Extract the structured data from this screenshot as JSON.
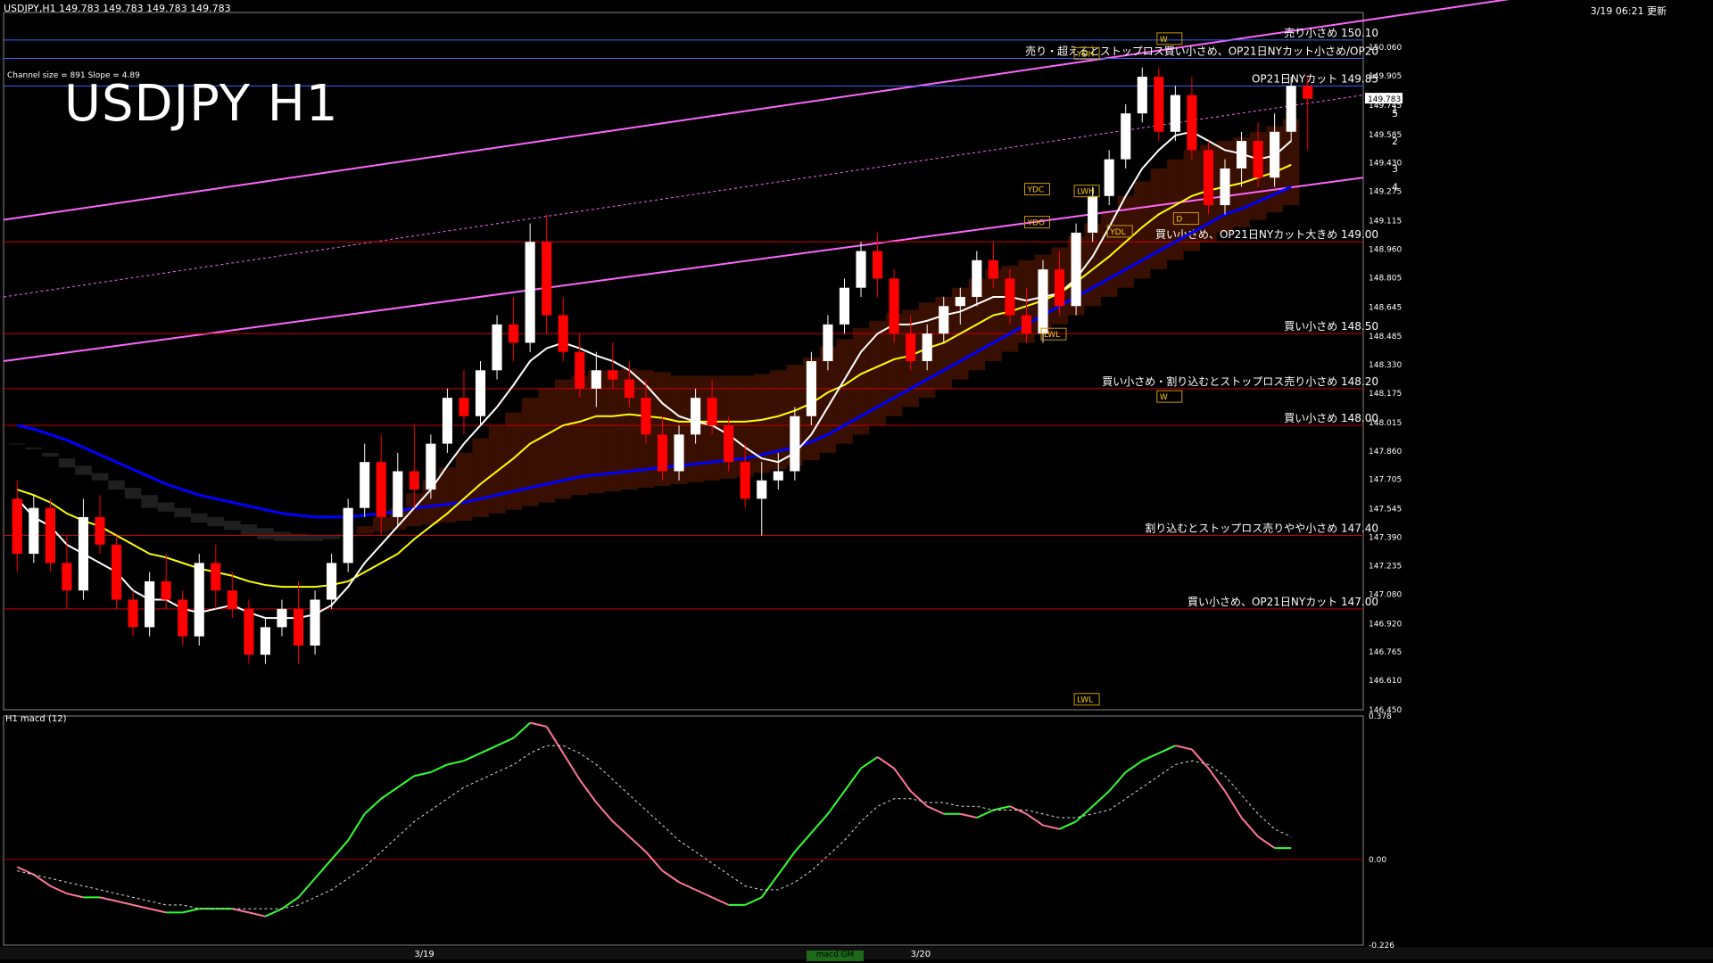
{
  "header": {
    "symbol_line": "USDJPY,H1  149.783 149.783 149.783 149.783",
    "updated": "3/19 06:21 更新",
    "big_title": "USDJPY H1",
    "channel_info": "Channel size = 891 Slope = 4.89",
    "macd_title": "H1  macd (12)",
    "indicator_tag": "macd GM"
  },
  "colors": {
    "background": "#000000",
    "bull_candle": "#ffffff",
    "bear_candle": "#ff0000",
    "ma_fast": "#ffffff",
    "ma_mid": "#ffff00",
    "ma_slow": "#0000ff",
    "cloud_bear": "#ff4400",
    "cloud_bull": "#2244ff",
    "channel_line": "#ff66ff",
    "level_line": "#cc0000",
    "macd_up": "#33ff33",
    "macd_down": "#ff7799",
    "chikou": "#22cc22"
  },
  "chart_data": {
    "type": "candlestick",
    "symbol": "USDJPY",
    "timeframe": "H1",
    "ylim": [
      146.45,
      150.25
    ],
    "y_ticks": [
      "150.060",
      "149.905",
      "149.745",
      "149.585",
      "149.430",
      "149.275",
      "149.115",
      "148.960",
      "148.805",
      "148.645",
      "148.485",
      "148.330",
      "148.175",
      "148.015",
      "147.860",
      "147.705",
      "147.545",
      "147.390",
      "147.235",
      "147.080",
      "146.920",
      "146.765",
      "146.610",
      "146.450"
    ],
    "current_price": "149.783",
    "x_labels": [
      {
        "label": "3/19",
        "index": 24
      },
      {
        "label": "3/20",
        "index": 54
      }
    ],
    "levels": [
      {
        "price": 150.1,
        "text": "売り小さめ 150.10",
        "color": "#3366ff"
      },
      {
        "price": 150.0,
        "text": "売り・超えるとストップロス買い小さめ、OP21日NYカット小さめ/OP20",
        "color": "#3366ff"
      },
      {
        "price": 149.85,
        "text": "OP21日NYカット 149.85",
        "color": "#3366ff"
      },
      {
        "price": 149.0,
        "text": "買い小さめ、OP21日NYカット大きめ 149.00",
        "color": "#cc0000"
      },
      {
        "price": 148.5,
        "text": "買い小さめ 148.50",
        "color": "#cc0000"
      },
      {
        "price": 148.2,
        "text": "買い小さめ・割り込むとストップロス売り小さめ 148.20",
        "color": "#cc0000"
      },
      {
        "price": 148.0,
        "text": "買い小さめ 148.00",
        "color": "#cc0000"
      },
      {
        "price": 147.4,
        "text": "割り込むとストップロス売りやや小さめ 147.40",
        "color": "#cc0000"
      },
      {
        "price": 147.0,
        "text": "買い小さめ、OP21日NYカット 147.00",
        "color": "#cc0000"
      }
    ],
    "candles": [
      [
        147.6,
        147.7,
        147.2,
        147.3
      ],
      [
        147.3,
        147.62,
        147.25,
        147.55
      ],
      [
        147.55,
        147.6,
        147.2,
        147.25
      ],
      [
        147.25,
        147.4,
        147.0,
        147.1
      ],
      [
        147.1,
        147.6,
        147.05,
        147.5
      ],
      [
        147.5,
        147.62,
        147.3,
        147.35
      ],
      [
        147.35,
        147.4,
        147.0,
        147.05
      ],
      [
        147.05,
        147.1,
        146.85,
        146.9
      ],
      [
        146.9,
        147.2,
        146.85,
        147.15
      ],
      [
        147.15,
        147.3,
        147.0,
        147.05
      ],
      [
        147.05,
        147.1,
        146.8,
        146.85
      ],
      [
        146.85,
        147.3,
        146.8,
        147.25
      ],
      [
        147.25,
        147.35,
        147.0,
        147.1
      ],
      [
        147.1,
        147.2,
        146.95,
        147.0
      ],
      [
        147.0,
        147.05,
        146.7,
        146.75
      ],
      [
        146.75,
        146.95,
        146.7,
        146.9
      ],
      [
        146.9,
        147.05,
        146.85,
        147.0
      ],
      [
        147.0,
        147.15,
        146.7,
        146.8
      ],
      [
        146.8,
        147.1,
        146.75,
        147.05
      ],
      [
        147.05,
        147.3,
        147.0,
        147.25
      ],
      [
        147.25,
        147.6,
        147.2,
        147.55
      ],
      [
        147.55,
        147.9,
        147.5,
        147.8
      ],
      [
        147.8,
        147.95,
        147.4,
        147.5
      ],
      [
        147.5,
        147.85,
        147.45,
        147.75
      ],
      [
        147.75,
        148.0,
        147.55,
        147.65
      ],
      [
        147.65,
        147.95,
        147.6,
        147.9
      ],
      [
        147.9,
        148.2,
        147.85,
        148.15
      ],
      [
        148.15,
        148.3,
        147.95,
        148.05
      ],
      [
        148.05,
        148.35,
        148.0,
        148.3
      ],
      [
        148.3,
        148.6,
        148.25,
        148.55
      ],
      [
        148.55,
        148.7,
        148.35,
        148.45
      ],
      [
        148.45,
        149.1,
        148.4,
        149.0
      ],
      [
        149.0,
        149.15,
        148.5,
        148.6
      ],
      [
        148.6,
        148.7,
        148.35,
        148.4
      ],
      [
        148.4,
        148.5,
        148.15,
        148.2
      ],
      [
        148.2,
        148.4,
        148.1,
        148.3
      ],
      [
        148.3,
        148.45,
        148.2,
        148.25
      ],
      [
        148.25,
        148.35,
        148.1,
        148.15
      ],
      [
        148.15,
        148.25,
        147.9,
        147.95
      ],
      [
        147.95,
        148.05,
        147.7,
        147.75
      ],
      [
        147.75,
        148.0,
        147.7,
        147.95
      ],
      [
        147.95,
        148.2,
        147.9,
        148.15
      ],
      [
        148.15,
        148.25,
        147.95,
        148.0
      ],
      [
        148.0,
        148.05,
        147.75,
        147.8
      ],
      [
        147.8,
        147.9,
        147.55,
        147.6
      ],
      [
        147.6,
        147.8,
        147.4,
        147.7
      ],
      [
        147.7,
        147.85,
        147.65,
        147.75
      ],
      [
        147.75,
        148.1,
        147.7,
        148.05
      ],
      [
        148.05,
        148.4,
        148.0,
        148.35
      ],
      [
        148.35,
        148.6,
        148.3,
        148.55
      ],
      [
        148.55,
        148.8,
        148.5,
        148.75
      ],
      [
        148.75,
        149.0,
        148.7,
        148.95
      ],
      [
        148.95,
        149.05,
        148.7,
        148.8
      ],
      [
        148.8,
        148.85,
        148.45,
        148.5
      ],
      [
        148.5,
        148.6,
        148.3,
        148.35
      ],
      [
        148.35,
        148.55,
        148.3,
        148.5
      ],
      [
        148.5,
        148.7,
        148.45,
        148.65
      ],
      [
        148.65,
        148.75,
        148.55,
        148.7
      ],
      [
        148.7,
        148.95,
        148.65,
        148.9
      ],
      [
        148.9,
        149.0,
        148.75,
        148.8
      ],
      [
        148.8,
        148.85,
        148.55,
        148.6
      ],
      [
        148.6,
        148.75,
        148.45,
        148.5
      ],
      [
        148.5,
        148.9,
        148.45,
        148.85
      ],
      [
        148.85,
        148.95,
        148.6,
        148.65
      ],
      [
        148.65,
        149.1,
        148.6,
        149.05
      ],
      [
        149.05,
        149.3,
        149.0,
        149.25
      ],
      [
        149.25,
        149.5,
        149.2,
        149.45
      ],
      [
        149.45,
        149.75,
        149.4,
        149.7
      ],
      [
        149.7,
        149.95,
        149.65,
        149.9
      ],
      [
        149.9,
        149.95,
        149.55,
        149.6
      ],
      [
        149.6,
        149.85,
        149.55,
        149.8
      ],
      [
        149.8,
        149.9,
        149.45,
        149.5
      ],
      [
        149.5,
        149.55,
        149.15,
        149.2
      ],
      [
        149.2,
        149.45,
        149.15,
        149.4
      ],
      [
        149.4,
        149.6,
        149.3,
        149.55
      ],
      [
        149.55,
        149.65,
        149.3,
        149.35
      ],
      [
        149.35,
        149.7,
        149.3,
        149.6
      ],
      [
        149.6,
        149.9,
        149.55,
        149.85
      ],
      [
        149.85,
        149.9,
        149.5,
        149.78
      ]
    ],
    "ma_fast": [
      147.6,
      147.5,
      147.45,
      147.35,
      147.3,
      147.25,
      147.2,
      147.1,
      147.05,
      147.05,
      147.0,
      146.98,
      147.0,
      147.02,
      146.98,
      146.95,
      146.95,
      146.95,
      146.97,
      147.02,
      147.12,
      147.25,
      147.35,
      147.45,
      147.55,
      147.65,
      147.78,
      147.9,
      148.0,
      148.1,
      148.22,
      148.35,
      148.42,
      148.45,
      148.42,
      148.38,
      148.35,
      148.3,
      148.22,
      148.12,
      148.05,
      148.02,
      148.0,
      147.95,
      147.88,
      147.82,
      147.8,
      147.85,
      147.95,
      148.1,
      148.25,
      148.4,
      148.5,
      148.55,
      148.55,
      148.57,
      148.6,
      148.62,
      148.66,
      148.7,
      148.7,
      148.68,
      148.7,
      148.72,
      148.8,
      148.92,
      149.08,
      149.25,
      149.4,
      149.5,
      149.58,
      149.6,
      149.55,
      149.5,
      149.48,
      149.45,
      149.47,
      149.55
    ],
    "ma_mid": [
      147.65,
      147.62,
      147.58,
      147.52,
      147.48,
      147.45,
      147.4,
      147.35,
      147.3,
      147.28,
      147.25,
      147.22,
      147.2,
      147.18,
      147.15,
      147.13,
      147.12,
      147.12,
      147.12,
      147.13,
      147.15,
      147.2,
      147.25,
      147.3,
      147.38,
      147.45,
      147.52,
      147.6,
      147.68,
      147.75,
      147.82,
      147.9,
      147.95,
      148.0,
      148.02,
      148.05,
      148.05,
      148.06,
      148.05,
      148.04,
      148.02,
      148.02,
      148.02,
      148.02,
      148.02,
      148.03,
      148.05,
      148.08,
      148.12,
      148.18,
      148.22,
      148.28,
      148.32,
      148.36,
      148.38,
      148.42,
      148.45,
      148.5,
      148.55,
      148.6,
      148.62,
      148.65,
      148.68,
      148.72,
      148.78,
      148.85,
      148.92,
      149.0,
      149.08,
      149.15,
      149.2,
      149.25,
      149.28,
      149.3,
      149.32,
      149.35,
      149.38,
      149.42
    ],
    "ma_slow": [
      148.0,
      147.98,
      147.95,
      147.92,
      147.88,
      147.84,
      147.8,
      147.76,
      147.72,
      147.68,
      147.65,
      147.62,
      147.6,
      147.58,
      147.56,
      147.54,
      147.52,
      147.51,
      147.5,
      147.5,
      147.5,
      147.51,
      147.52,
      147.53,
      147.55,
      147.56,
      147.57,
      147.58,
      147.6,
      147.62,
      147.64,
      147.66,
      147.68,
      147.7,
      147.72,
      147.73,
      147.74,
      147.75,
      147.76,
      147.77,
      147.78,
      147.79,
      147.8,
      147.81,
      147.82,
      147.84,
      147.86,
      147.88,
      147.91,
      147.95,
      148.0,
      148.05,
      148.1,
      148.15,
      148.2,
      148.25,
      148.3,
      148.35,
      148.4,
      148.45,
      148.5,
      148.55,
      148.6,
      148.65,
      148.7,
      148.75,
      148.8,
      148.85,
      148.9,
      148.95,
      149.0,
      149.05,
      149.1,
      149.15,
      149.18,
      149.22,
      149.26,
      149.3
    ],
    "macd_ylim": [
      -0.226,
      0.378
    ],
    "macd_ticks": [
      "0.378",
      "0.00",
      "-0.226"
    ],
    "macd": [
      -0.02,
      -0.04,
      -0.07,
      -0.09,
      -0.1,
      -0.1,
      -0.11,
      -0.12,
      -0.13,
      -0.14,
      -0.14,
      -0.13,
      -0.13,
      -0.13,
      -0.14,
      -0.15,
      -0.13,
      -0.1,
      -0.05,
      0.0,
      0.05,
      0.12,
      0.16,
      0.19,
      0.22,
      0.23,
      0.25,
      0.26,
      0.28,
      0.3,
      0.32,
      0.36,
      0.35,
      0.28,
      0.21,
      0.15,
      0.1,
      0.06,
      0.02,
      -0.03,
      -0.06,
      -0.08,
      -0.1,
      -0.12,
      -0.12,
      -0.1,
      -0.04,
      0.02,
      0.07,
      0.12,
      0.18,
      0.24,
      0.27,
      0.24,
      0.18,
      0.14,
      0.12,
      0.12,
      0.11,
      0.13,
      0.14,
      0.12,
      0.09,
      0.08,
      0.1,
      0.14,
      0.18,
      0.23,
      0.26,
      0.28,
      0.3,
      0.29,
      0.24,
      0.18,
      0.11,
      0.06,
      0.03,
      0.03
    ],
    "macd_signal": [
      -0.03,
      -0.04,
      -0.05,
      -0.06,
      -0.07,
      -0.08,
      -0.09,
      -0.1,
      -0.11,
      -0.12,
      -0.12,
      -0.13,
      -0.13,
      -0.13,
      -0.13,
      -0.13,
      -0.13,
      -0.12,
      -0.1,
      -0.08,
      -0.05,
      -0.02,
      0.02,
      0.06,
      0.1,
      0.13,
      0.16,
      0.19,
      0.21,
      0.23,
      0.25,
      0.28,
      0.3,
      0.3,
      0.28,
      0.25,
      0.21,
      0.17,
      0.13,
      0.09,
      0.05,
      0.02,
      -0.01,
      -0.04,
      -0.07,
      -0.08,
      -0.08,
      -0.06,
      -0.03,
      0.01,
      0.05,
      0.1,
      0.14,
      0.16,
      0.16,
      0.15,
      0.15,
      0.14,
      0.14,
      0.13,
      0.13,
      0.13,
      0.12,
      0.11,
      0.11,
      0.12,
      0.13,
      0.16,
      0.19,
      0.22,
      0.25,
      0.26,
      0.25,
      0.22,
      0.17,
      0.12,
      0.08,
      0.06
    ]
  },
  "labels": {
    "tags": [
      {
        "text": "YDH",
        "price": 150.02,
        "index": 64
      },
      {
        "text": "YDC",
        "price": 149.28,
        "index": 61
      },
      {
        "text": "YDO",
        "price": 149.1,
        "index": 61
      },
      {
        "text": "YDL",
        "price": 149.05,
        "index": 66
      },
      {
        "text": "LWH",
        "price": 149.27,
        "index": 64
      },
      {
        "text": "LWL",
        "price": 148.49,
        "index": 62
      },
      {
        "text": "LWL",
        "price": 146.5,
        "index": 64
      },
      {
        "text": "W",
        "price": 150.1,
        "index": 69
      },
      {
        "text": "W",
        "price": 148.15,
        "index": 69
      },
      {
        "text": "D",
        "price": 149.12,
        "index": 70
      }
    ],
    "projection_numbers": [
      "1",
      "5",
      "2",
      "3",
      "4"
    ]
  }
}
